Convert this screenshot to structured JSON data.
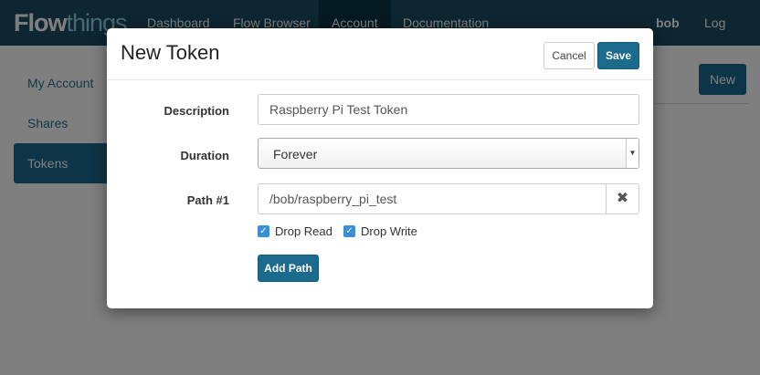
{
  "navbar": {
    "brand_part1": "Flow",
    "brand_part2": "things",
    "items": [
      {
        "label": "Dashboard",
        "active": false
      },
      {
        "label": "Flow Browser",
        "active": false
      },
      {
        "label": "Account",
        "active": true
      },
      {
        "label": "Documentation",
        "active": false
      }
    ],
    "user": "bob",
    "logout_label": "Log Out"
  },
  "sidebar": {
    "items": [
      {
        "label": "My Account",
        "active": false
      },
      {
        "label": "Shares",
        "active": false
      },
      {
        "label": "Tokens",
        "active": true
      }
    ]
  },
  "page": {
    "new_label": "New"
  },
  "modal": {
    "title": "New Token",
    "cancel_label": "Cancel",
    "save_label": "Save",
    "description": {
      "label": "Description",
      "value": "Raspberry Pi Test Token"
    },
    "duration": {
      "label": "Duration",
      "value": "Forever"
    },
    "path": {
      "label": "Path #1",
      "value": "/bob/raspberry_pi_test"
    },
    "drop_read": {
      "label": "Drop Read",
      "checked": true
    },
    "drop_write": {
      "label": "Drop Write",
      "checked": true
    },
    "add_path_label": "Add Path"
  },
  "colors": {
    "navbar": "#1b4d63",
    "accent": "#1b6b8f",
    "checkbox": "#3a8fd6"
  },
  "icons": {
    "path_clear": "close-icon",
    "select_arrow": "chevron-down-icon",
    "checkbox": "checkmark-icon"
  }
}
